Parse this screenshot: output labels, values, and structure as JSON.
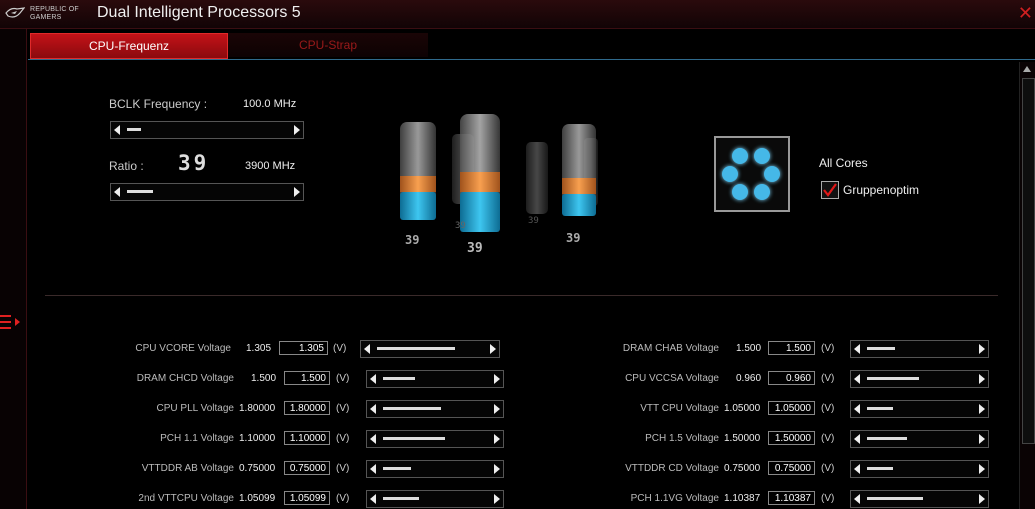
{
  "window": {
    "logo_line1": "REPUBLIC OF",
    "logo_line2": "GAMERS",
    "title": "Dual Intelligent Processors 5",
    "close_glyph": "✕"
  },
  "tabs": [
    {
      "label": "CPU-Frequenz",
      "active": true
    },
    {
      "label": "CPU-Strap",
      "active": false
    }
  ],
  "frequency": {
    "bclk_label": "BCLK Frequency :",
    "bclk_value": "100.0  MHz",
    "ratio_label": "Ratio :",
    "ratio_digits": "39",
    "ratio_mhz": "3900  MHz"
  },
  "cylinders": {
    "labels": [
      "39",
      "39",
      "39",
      "39",
      "39"
    ]
  },
  "cores": {
    "all_cores_label": "All Cores",
    "group_label": "Gruppenoptim",
    "group_checked": true
  },
  "voltages_left": [
    {
      "label": "CPU VCORE Voltage",
      "value": "1.305",
      "box": "1.305",
      "unit": "(V)"
    },
    {
      "label": "DRAM CHCD Voltage",
      "value": "1.500",
      "box": "1.500",
      "unit": "(V)"
    },
    {
      "label": "CPU PLL Voltage",
      "value": "1.80000",
      "box": "1.80000",
      "unit": "(V)"
    },
    {
      "label": "PCH 1.1 Voltage",
      "value": "1.10000",
      "box": "1.10000",
      "unit": "(V)"
    },
    {
      "label": "VTTDDR AB Voltage",
      "value": "0.75000",
      "box": "0.75000",
      "unit": "(V)"
    },
    {
      "label": "2nd VTTCPU Voltage",
      "value": "1.05099",
      "box": "1.05099",
      "unit": "(V)"
    }
  ],
  "voltages_right": [
    {
      "label": "DRAM CHAB Voltage",
      "value": "1.500",
      "box": "1.500",
      "unit": "(V)"
    },
    {
      "label": "CPU VCCSA Voltage",
      "value": "0.960",
      "box": "0.960",
      "unit": "(V)"
    },
    {
      "label": "VTT CPU Voltage",
      "value": "1.05000",
      "box": "1.05000",
      "unit": "(V)"
    },
    {
      "label": "PCH 1.5 Voltage",
      "value": "1.50000",
      "box": "1.50000",
      "unit": "(V)"
    },
    {
      "label": "VTTDDR CD Voltage",
      "value": "0.75000",
      "box": "0.75000",
      "unit": "(V)"
    },
    {
      "label": "PCH 1.1VG Voltage",
      "value": "1.10387",
      "box": "1.10387",
      "unit": "(V)"
    }
  ],
  "colors": {
    "accent": "#c41218",
    "core_dot": "#45b8e8",
    "liquid": "#1aa8d8",
    "band": "#f08a30"
  }
}
